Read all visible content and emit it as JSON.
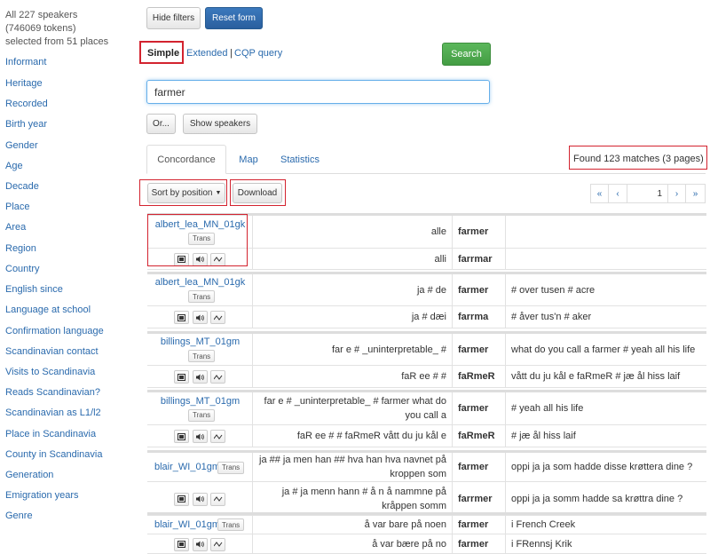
{
  "sidebar": {
    "summary": [
      "All 227 speakers",
      "(746069 tokens)",
      "selected from 51 places"
    ],
    "filters": [
      "Informant",
      "Heritage",
      "Recorded",
      "Birth year",
      "Gender",
      "Age",
      "Decade",
      "Place",
      "Area",
      "Region",
      "Country",
      "English since",
      "Language at school",
      "Confirmation language",
      "Scandinavian contact",
      "Visits to Scandinavia",
      "Reads Scandinavian?",
      "Scandinavian as L1/l2",
      "Place in Scandinavia",
      "County in Scandinavia",
      "Generation",
      "Emigration years",
      "Genre"
    ]
  },
  "toolbar": {
    "hide_filters": "Hide filters",
    "reset_form": "Reset form"
  },
  "modes": {
    "simple": "Simple",
    "extended": "Extended",
    "separator": "|",
    "cqp": "CQP query"
  },
  "search": {
    "button": "Search",
    "query": "farmer"
  },
  "actions": {
    "or": "Or...",
    "show_speakers": "Show speakers"
  },
  "result_tabs": [
    "Concordance",
    "Map",
    "Statistics"
  ],
  "found": "Found 123 matches (3 pages)",
  "sort_label": "Sort by position",
  "download_label": "Download",
  "pager": {
    "first": "«",
    "prev": "‹",
    "page": "1",
    "next": "›",
    "last": "»"
  },
  "trans_label": "Trans",
  "icons": {
    "video": "film-icon",
    "audio": "speaker-icon",
    "waveform": "waveform-icon"
  },
  "results": [
    {
      "speaker": "albert_lea_MN_01gk",
      "left": "alle",
      "match": "farmer",
      "right": "",
      "left2": "alli",
      "match2": "farrmar",
      "right2": ""
    },
    {
      "speaker": "albert_lea_MN_01gk",
      "left": "ja # de",
      "match": "farmer",
      "right": "# over tusen # acre",
      "left2": "ja # dæi",
      "match2": "farrma",
      "right2": "# åver tus'n # aker"
    },
    {
      "speaker": "billings_MT_01gm",
      "left": "far e # _uninterpretable_ #",
      "match": "farmer",
      "right": "what do you call a farmer # yeah all his life",
      "left2": "faR ee # #",
      "match2": "faRmeR",
      "right2": "vått du ju kål e faRmeR # jæ ål hiss laif"
    },
    {
      "speaker": "billings_MT_01gm",
      "left": "far e # _uninterpretable_ # farmer what do you call a",
      "match": "farmer",
      "right": "# yeah all his life",
      "left2": "faR ee # # faRmeR vått du ju kål e",
      "match2": "faRmeR",
      "right2": "# jæ ål hiss laif"
    },
    {
      "speaker": "blair_WI_01gm",
      "left": "ja ## ja men han ## hva han hva navnet på kroppen som",
      "match": "farmer",
      "right": "oppi ja ja som hadde disse krøttera dine ?",
      "left2": "ja # ja menn hann # å n å nammne på kråppen somm",
      "match2": "farrmer",
      "right2": "oppi ja ja somm hadde sa krøttra dine ?"
    },
    {
      "speaker": "blair_WI_01gm",
      "left": "å var bare på noen",
      "match": "farmer",
      "right": "i French Creek",
      "left2": "å var bære på no",
      "match2": "farmer",
      "right2": "i FRennsj Krik"
    }
  ]
}
